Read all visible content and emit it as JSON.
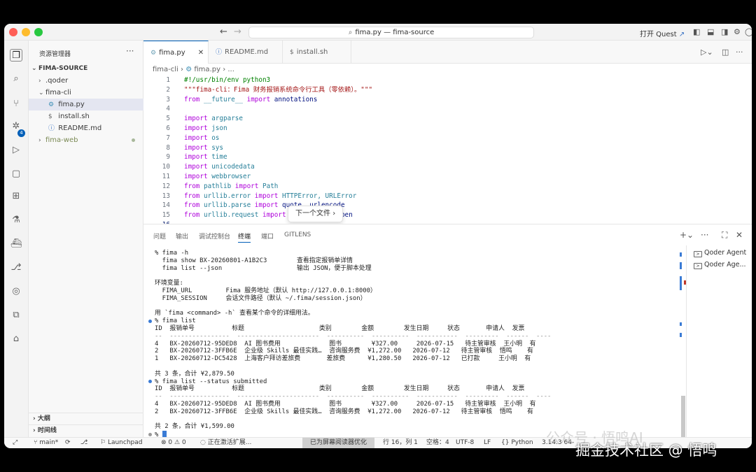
{
  "window": {
    "title": "fima.py — fima-source",
    "open_quest": "打开 Quest"
  },
  "sidebar": {
    "title": "资源管理器",
    "root": "FIMA-SOURCE",
    "items": [
      {
        "label": ".qoder"
      },
      {
        "label": "fima-cli"
      },
      {
        "label": "fima.py"
      },
      {
        "label": "install.sh"
      },
      {
        "label": "README.md"
      },
      {
        "label": "fima-web"
      }
    ],
    "outline": "大纲",
    "timeline": "时间线",
    "scm_badge": "4"
  },
  "tabs": [
    {
      "label": "fima.py"
    },
    {
      "label": "README.md"
    },
    {
      "label": "install.sh"
    }
  ],
  "breadcrumb": {
    "folder": "fima-cli",
    "file": "fima.py",
    "more": "..."
  },
  "code": {
    "line_numbers": [
      "1",
      "2",
      "3",
      "4",
      "5",
      "6",
      "7",
      "8",
      "9",
      "10",
      "11",
      "12",
      "13",
      "14",
      "15",
      "16"
    ],
    "l1": "#!/usr/bin/env python3",
    "l2": "\"\"\"fima-cli：Fima 财务报销系统命令行工具（零依赖）。\"\"\"",
    "l3_a": "from",
    "l3_b": "__future__",
    "l3_c": "import",
    "l3_d": "annotations",
    "imports": [
      "argparse",
      "json",
      "os",
      "sys",
      "time",
      "unicodedata",
      "webbrowser"
    ],
    "import_kw": "import",
    "from_kw": "from",
    "l12_mod": "pathlib",
    "l12_name": "Path",
    "l13_mod": "urllib.error",
    "l13_name": "HTTPError, URLError",
    "l14_mod": "urllib.parse",
    "l14_name": "quote, urlencode",
    "l15_mod": "urllib.request",
    "l15_name": "Request, urlopen"
  },
  "float_button": "下一个文件",
  "panel": {
    "tabs": [
      "问题",
      "输出",
      "调试控制台",
      "终端",
      "端口",
      "GITLENS"
    ],
    "terminals": [
      "Qoder Agent",
      "Qoder Age..."
    ]
  },
  "terminal": {
    "lines": [
      "% fima -h",
      "  fima show BX-20260801-A1B2C3        查看指定报销单详情",
      "  fima list --json                    输出 JSON，便于脚本处理",
      "",
      "环境变量:",
      "  FIMA_URL         Fima 服务地址（默认 http://127.0.0.1:8000）",
      "  FIMA_SESSION     会话文件路径（默认 ~/.fima/session.json）",
      "",
      "用 `fima <command> -h` 查看某个命令的详细用法。",
      "% fima list",
      "ID  报销单号          标题                    类别        金额        发生日期     状态       申请人  发票",
      "--  ----------------  ----------------------  ----------  ----------  -----------  ---------  ------  ----",
      "4   BX-20260712-95DED8  AI 图书费用             图书        ¥327.00     2026-07-15   待主管审核  王小明  有",
      "2   BX-20260712-3FFB6E  企业级 Skills 最佳实践…  咨询服务费  ¥1,272.00   2026-07-12   待主管审核  悟鸣    有",
      "1   BX-20260712-DC5428  上海客户拜访差旅费       差旅费      ¥1,280.50   2026-07-12   已打款     王小明  有",
      "",
      "共 3 条，合计 ¥2,879.50",
      "% fima list --status submitted",
      "ID  报销单号          标题                    类别        金额        发生日期     状态       申请人  发票",
      "--  ----------------  ----------------------  ----------  ----------  -----------  ---------  ------  ----",
      "4   BX-20260712-95DED8  AI 图书费用             图书        ¥327.00     2026-07-15   待主管审核  王小明  有",
      "2   BX-20260712-3FFB6E  企业级 Skills 最佳实践…  咨询服务费  ¥1,272.00   2026-07-12   待主管审核  悟鸣    有",
      "",
      "共 2 条，合计 ¥1,599.00",
      "%"
    ]
  },
  "status": {
    "branch": "main*",
    "launchpad": "Launchpad",
    "errors": "0",
    "warnings": "0",
    "activating": "正在激活扩展...",
    "screen_reader": "已为屏幕阅读器优化",
    "position": "行 16，列 1",
    "spaces": "空格：4",
    "encoding": "UTF-8",
    "eol": "LF",
    "language": "Python",
    "version": "3.14.3 64-"
  },
  "watermark": {
    "line1": "公众号 · 悟鸣AI",
    "line2": "掘金技术社区 @ 悟鸣"
  }
}
